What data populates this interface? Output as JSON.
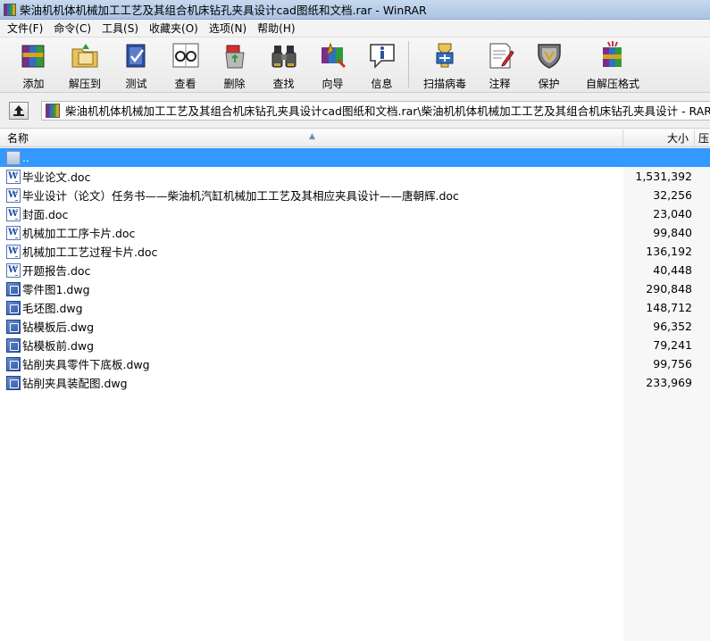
{
  "window": {
    "title": "柴油机机体机械加工工艺及其组合机床钻孔夹具设计cad图纸和文档.rar - WinRAR"
  },
  "menu": [
    {
      "label": "文件(F)"
    },
    {
      "label": "命令(C)"
    },
    {
      "label": "工具(S)"
    },
    {
      "label": "收藏夹(O)"
    },
    {
      "label": "选项(N)"
    },
    {
      "label": "帮助(H)"
    }
  ],
  "toolbar": {
    "buttons": [
      {
        "label": "添加",
        "icon": "add-books-icon"
      },
      {
        "label": "解压到",
        "icon": "extract-folder-icon"
      },
      {
        "label": "测试",
        "icon": "test-check-icon"
      },
      {
        "label": "查看",
        "icon": "view-glasses-icon"
      },
      {
        "label": "删除",
        "icon": "delete-recycle-icon"
      },
      {
        "label": "查找",
        "icon": "find-binoculars-icon"
      },
      {
        "label": "向导",
        "icon": "wizard-icon"
      },
      {
        "label": "信息",
        "icon": "info-icon"
      },
      {
        "label": "扫描病毒",
        "icon": "virus-scan-icon"
      },
      {
        "label": "注释",
        "icon": "comment-icon"
      },
      {
        "label": "保护",
        "icon": "protect-shield-icon"
      },
      {
        "label": "自解压格式",
        "icon": "sfx-archive-icon"
      }
    ]
  },
  "address": {
    "path": "柴油机机体机械加工工艺及其组合机床钻孔夹具设计cad图纸和文档.rar\\柴油机机体机械加工工艺及其组合机床钻孔夹具设计 - RAR 压缩"
  },
  "columns": {
    "name": "名称",
    "size": "大小",
    "more": "压"
  },
  "files": [
    {
      "name": "..",
      "size": "",
      "type": "up",
      "selected": true
    },
    {
      "name": "毕业论文.doc",
      "size": "1,531,392",
      "type": "doc"
    },
    {
      "name": "毕业设计（论文）任务书——柴油机汽缸机械加工工艺及其相应夹具设计——唐朝辉.doc",
      "size": "32,256",
      "type": "doc"
    },
    {
      "name": "封面.doc",
      "size": "23,040",
      "type": "doc"
    },
    {
      "name": "机械加工工序卡片.doc",
      "size": "99,840",
      "type": "doc"
    },
    {
      "name": "机械加工工艺过程卡片.doc",
      "size": "136,192",
      "type": "doc"
    },
    {
      "name": "开题报告.doc",
      "size": "40,448",
      "type": "doc"
    },
    {
      "name": "零件图1.dwg",
      "size": "290,848",
      "type": "dwg"
    },
    {
      "name": "毛坯图.dwg",
      "size": "148,712",
      "type": "dwg"
    },
    {
      "name": "钻模板后.dwg",
      "size": "96,352",
      "type": "dwg"
    },
    {
      "name": "钻模板前.dwg",
      "size": "79,241",
      "type": "dwg"
    },
    {
      "name": "钻削夹具零件下底板.dwg",
      "size": "99,756",
      "type": "dwg"
    },
    {
      "name": "钻削夹具装配图.dwg",
      "size": "233,969",
      "type": "dwg"
    }
  ]
}
